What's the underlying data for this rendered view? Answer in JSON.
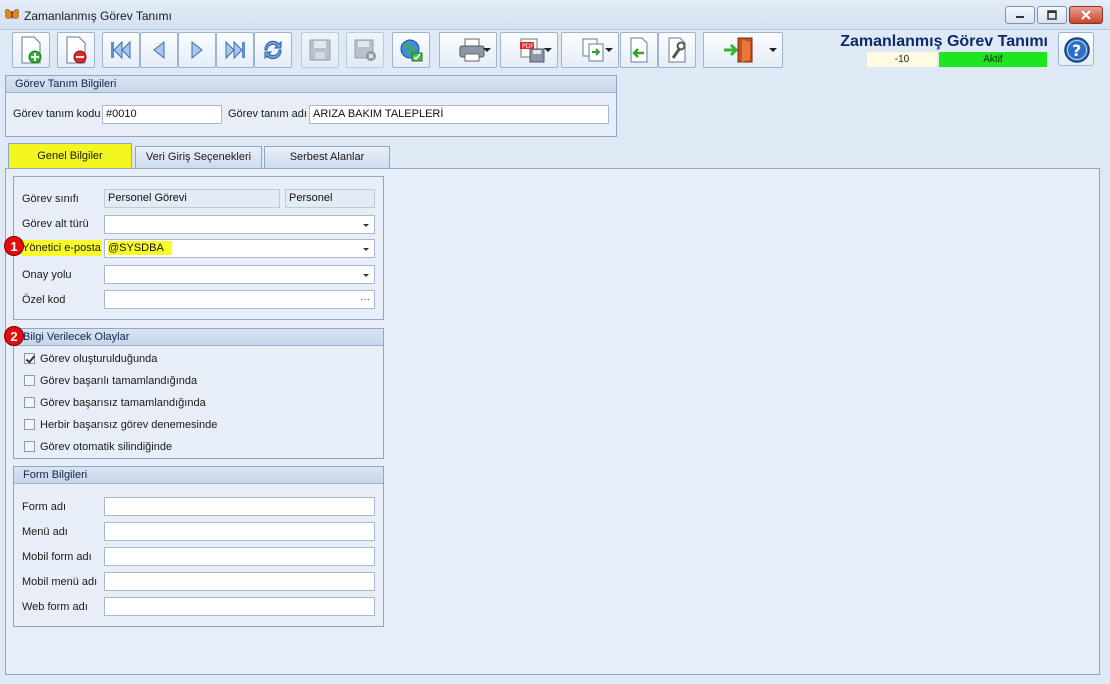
{
  "window": {
    "title": "Zamanlanmış Görev Tanımı",
    "icon": "butterfly-icon"
  },
  "toolbar": {
    "buttons": [
      "new-document-icon",
      "delete-document-icon",
      "first-record-icon",
      "previous-record-icon",
      "next-record-icon",
      "last-record-icon",
      "refresh-icon",
      "save-icon",
      "save-close-icon",
      "web-icon",
      "print-icon",
      "pdf-export-icon",
      "copy-icon",
      "import-icon",
      "tools-icon",
      "exit-icon"
    ]
  },
  "header": {
    "title": "Zamanlanmış Görev Tanımı",
    "count": "-10",
    "status": "Aktif",
    "status_color": "#1ee61e"
  },
  "definition": {
    "group_title": "Görev Tanım Bilgileri",
    "code_label": "Görev tanım kodu",
    "code_value": "#0010",
    "name_label": "Görev tanım adı",
    "name_value": "ARIZA BAKIM TALEPLERİ"
  },
  "tabs": [
    {
      "label": "Genel Bilgiler"
    },
    {
      "label": "Veri Giriş Seçenekleri"
    },
    {
      "label": "Serbest Alanlar"
    }
  ],
  "general": {
    "class_label": "Görev sınıfı",
    "class_value": "Personel Görevi",
    "class_value2": "Personel",
    "subtype_label": "Görev alt türü",
    "subtype_value": "",
    "email_label": "Yönetici e-posta",
    "email_value": "@SYSDBA",
    "approval_label": "Onay yolu",
    "approval_value": "",
    "special_label": "Özel kod",
    "special_value": "",
    "ellipsis": "···"
  },
  "events": {
    "group_title": "Bilgi Verilecek Olaylar",
    "items": [
      {
        "label": "Görev oluşturulduğunda",
        "checked": true
      },
      {
        "label": "Görev başarılı tamamlandığında",
        "checked": false
      },
      {
        "label": "Görev başarısız tamamlandığında",
        "checked": false
      },
      {
        "label": "Herbir başarısız görev denemesinde",
        "checked": false
      },
      {
        "label": "Görev otomatik silindiğinde",
        "checked": false
      }
    ]
  },
  "form_info": {
    "group_title": "Form Bilgileri",
    "fields": [
      {
        "label": "Form adı",
        "value": ""
      },
      {
        "label": "Menü adı",
        "value": ""
      },
      {
        "label": "Mobil form adı",
        "value": ""
      },
      {
        "label": "Mobil menü adı",
        "value": ""
      },
      {
        "label": "Web form adı",
        "value": ""
      }
    ]
  },
  "badges": [
    "1",
    "2"
  ],
  "colors": {
    "active_tab": "#f3f71f",
    "highlight": "#fbfb2a",
    "badge": "#e30d0d",
    "heading": "#0f2a6b"
  }
}
